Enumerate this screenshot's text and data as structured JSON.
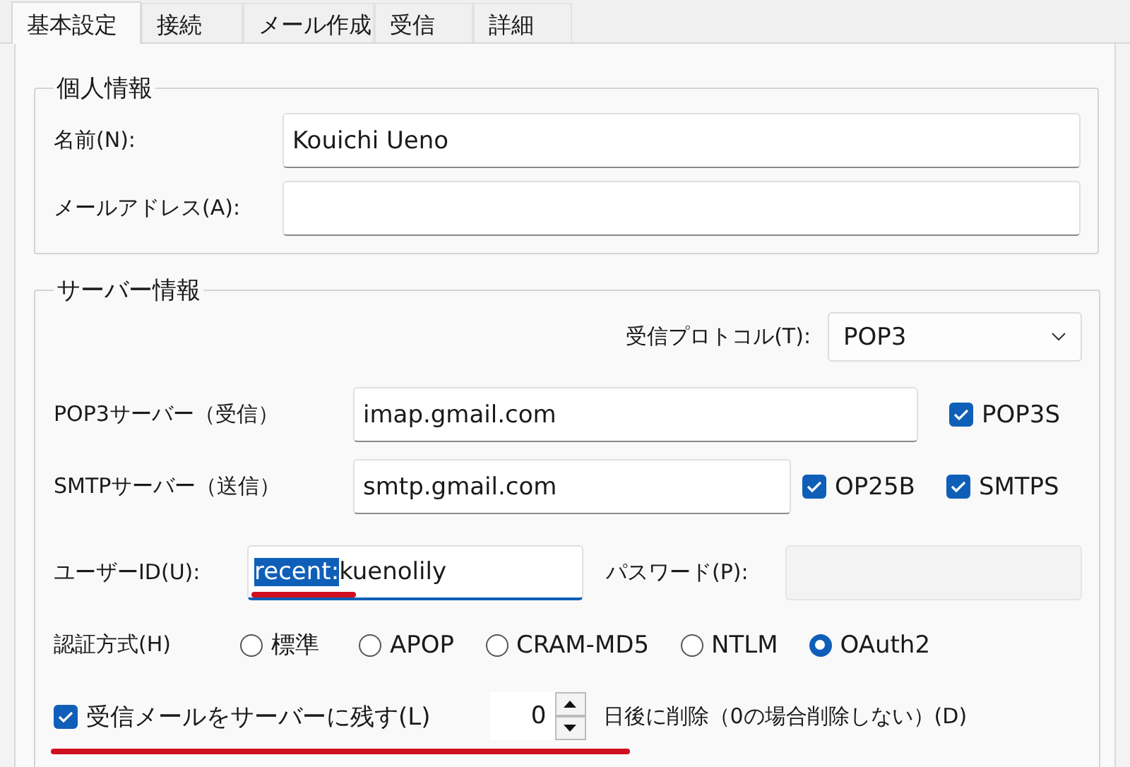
{
  "tabs": [
    {
      "label": "基本設定",
      "selected": true
    },
    {
      "label": "接続",
      "selected": false
    },
    {
      "label": "メール作成",
      "selected": false
    },
    {
      "label": "受信",
      "selected": false
    },
    {
      "label": "詳細",
      "selected": false
    }
  ],
  "personal": {
    "title": "個人情報",
    "fields": [
      {
        "label": "名前(N):",
        "value": "Kouichi Ueno"
      },
      {
        "label": "メールアドレス(A):"
      }
    ]
  },
  "server": {
    "title": "サーバー情報",
    "protocol": {
      "label": "受信プロトコル(T):",
      "value": "POP3"
    },
    "servers": [
      {
        "label": "POP3サーバー（受信）",
        "value": "imap.gmail.com",
        "options": [
          {
            "label": "POP3S",
            "checked": true
          }
        ]
      },
      {
        "label": "SMTPサーバー（送信）",
        "value": "smtp.gmail.com",
        "options": [
          {
            "label": "OP25B",
            "checked": true
          },
          {
            "label": "SMTPS",
            "checked": true
          }
        ]
      }
    ],
    "user": {
      "label": "ユーザーID(U):",
      "selected_text": "recent:",
      "value": "kuenolily",
      "focused": true,
      "underlined": true
    },
    "password": {
      "label": "パスワード(P):",
      "disabled": true
    },
    "auth": {
      "label": "認証方式(H)",
      "options": [
        {
          "label": "標準",
          "selected": false
        },
        {
          "label": "APOP",
          "selected": false
        },
        {
          "label": "CRAM-MD5",
          "selected": false
        },
        {
          "label": "NTLM",
          "selected": false
        },
        {
          "label": "OAuth2",
          "selected": true
        }
      ]
    },
    "keep": {
      "label": "受信メールをサーバーに残す(L)",
      "checked": true,
      "underlined": true,
      "days": "0",
      "suffix": "日後に削除（0の場合削除しない）(D)"
    }
  }
}
